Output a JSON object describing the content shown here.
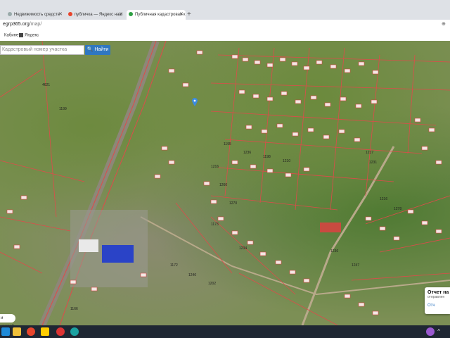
{
  "browser": {
    "tabs": [
      {
        "label": "Недвижимость средств",
        "icon": "page-icon",
        "active": false
      },
      {
        "label": "публичка — Яндекс наш",
        "icon": "yandex-icon",
        "active": false
      },
      {
        "label": "Публичная кадастровая к",
        "icon": "check-icon",
        "active": true
      }
    ],
    "new_tab": "+",
    "url_host": "egrp365.org",
    "url_path": "/map/",
    "bookmarks": [
      {
        "label": "Кабинеты",
        "icon": "apps-icon"
      },
      {
        "label": "Яндекс",
        "icon": "bookmark-icon"
      }
    ]
  },
  "map": {
    "search_placeholder": "Кадастровый номер участка",
    "search_button": "Найти",
    "parcel_labels": [
      "4621",
      "1199",
      "1195",
      "1236",
      "1198",
      "1210",
      "1217",
      "1231",
      "1216",
      "1260",
      "1270",
      "1173",
      "1234",
      "1172",
      "1240",
      "1202",
      "1216",
      "1278",
      "1236",
      "1247",
      "1166"
    ],
    "notification": {
      "title": "Отчет на",
      "subtitle": "отправлен",
      "action": "Отч"
    },
    "help_text": "и карте?"
  },
  "colors": {
    "parcel_border": "#e04a4a",
    "search_button": "#2f77c1",
    "marker": "#3b8be0"
  }
}
